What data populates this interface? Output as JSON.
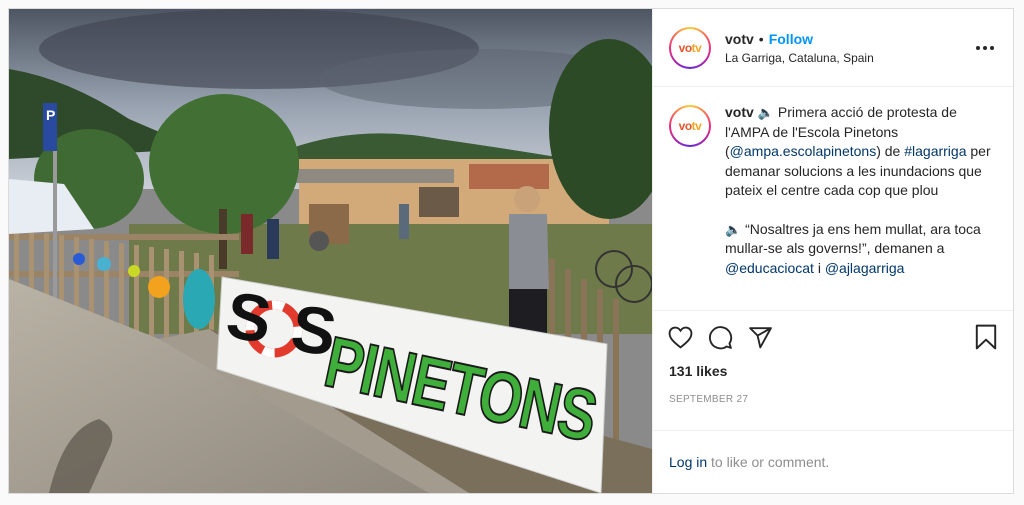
{
  "post": {
    "username": "votv",
    "follow_label": "Follow",
    "separator": "•",
    "location": "La Garriga, Cataluna, Spain",
    "more_label": "•••",
    "avatar_text_a": "vo",
    "avatar_text_b": "tv",
    "caption": {
      "username": "votv",
      "speaker_icon": "🔈",
      "part1": "Primera acció de protesta de l'AMPA de l'Escola Pinetons (",
      "mention1": "@ampa.escolapinetons",
      "part2": ") de ",
      "hashtag1": "#lagarriga",
      "part3": " per demanar solucions a les inundacions que pateix el centre cada cop que plou",
      "speaker_icon2": "🔈",
      "part4": " “Nosaltres ja ens hem mullat, ara toca mullar-se als governs!”, demanen a ",
      "mention2": "@educaciocat",
      "part5": " i ",
      "mention3": "@ajlagarriga"
    },
    "likes": "131 likes",
    "date": "SEPTEMBER 27",
    "login_link": "Log in",
    "login_rest": " to like or comment."
  },
  "photo": {
    "banner_sos_1": "S",
    "banner_sos_2": "S",
    "banner_word": "PINETONS",
    "parking_sign": "P"
  },
  "icons": [
    "heart-icon",
    "comment-icon",
    "share-icon",
    "bookmark-icon",
    "more-options-icon"
  ],
  "colors": {
    "accent": "#0095f6",
    "link": "#00376b",
    "banner_green": "#3fae3a"
  }
}
